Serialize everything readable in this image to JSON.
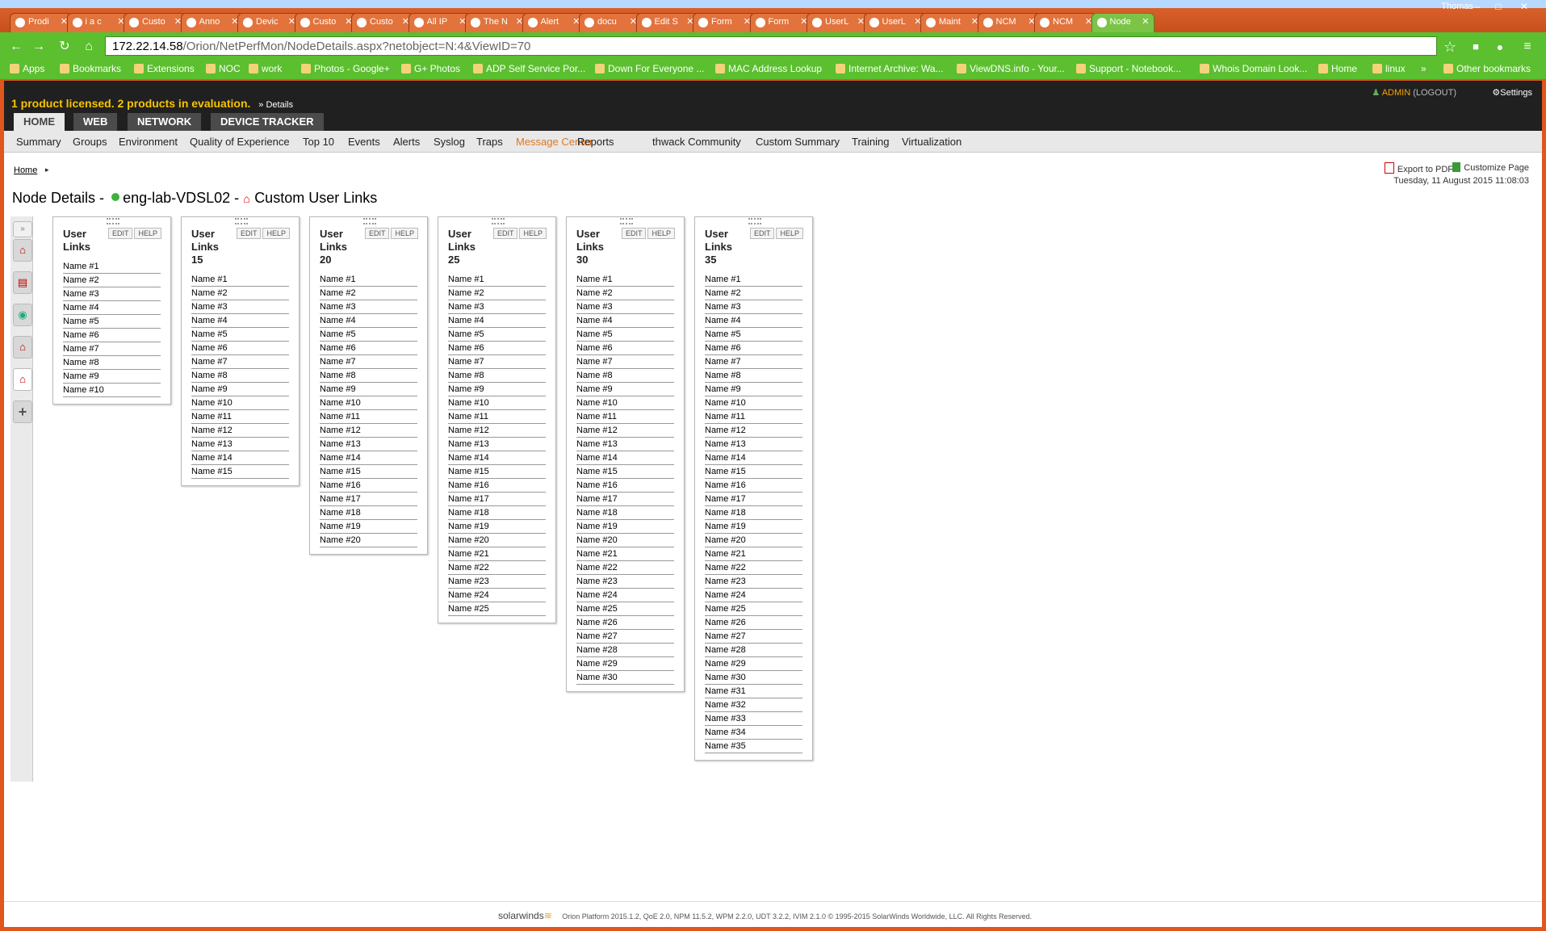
{
  "browser": {
    "tabs": [
      {
        "label": "Prodi"
      },
      {
        "label": "i a c"
      },
      {
        "label": "Custo"
      },
      {
        "label": "Anno"
      },
      {
        "label": "Devic"
      },
      {
        "label": "Custo"
      },
      {
        "label": "Custo"
      },
      {
        "label": "All IP"
      },
      {
        "label": "The N"
      },
      {
        "label": "Alert"
      },
      {
        "label": "docu"
      },
      {
        "label": "Edit S"
      },
      {
        "label": "Form"
      },
      {
        "label": "Form"
      },
      {
        "label": "UserL"
      },
      {
        "label": "UserL"
      },
      {
        "label": "Maint"
      },
      {
        "label": "NCM"
      },
      {
        "label": "NCM"
      },
      {
        "label": "Node"
      }
    ],
    "profile_name": "Thomas",
    "url_host": "172.22.14.58",
    "url_path": "/Orion/NetPerfMon/NodeDetails.aspx?netobject=N:4&ViewID=70",
    "bookmarks": [
      {
        "label": "Apps"
      },
      {
        "label": "Bookmarks"
      },
      {
        "label": "Extensions"
      },
      {
        "label": "NOC"
      },
      {
        "label": "work"
      },
      {
        "label": "Photos - Google+"
      },
      {
        "label": "G+ Photos"
      },
      {
        "label": "ADP Self Service Por..."
      },
      {
        "label": "Down For Everyone ..."
      },
      {
        "label": "MAC Address Lookup"
      },
      {
        "label": "Internet Archive: Wa..."
      },
      {
        "label": "ViewDNS.info - Your..."
      },
      {
        "label": "Support - Notebook..."
      },
      {
        "label": "Whois Domain Look..."
      },
      {
        "label": "Home"
      },
      {
        "label": "linux"
      },
      {
        "label": "»"
      },
      {
        "label": "Other bookmarks"
      }
    ]
  },
  "header": {
    "license_text": "1 product licensed.  2 products in evaluation.",
    "details_link": "» Details",
    "admin_user": "ADMIN",
    "logout": "(LOGOUT)",
    "settings": "Settings",
    "top_tabs": [
      {
        "label": "HOME",
        "active": true
      },
      {
        "label": "WEB",
        "active": false
      },
      {
        "label": "NETWORK",
        "active": false
      },
      {
        "label": "DEVICE TRACKER",
        "active": false
      }
    ],
    "menu": [
      {
        "label": "Summary"
      },
      {
        "label": "Groups"
      },
      {
        "label": "Environment"
      },
      {
        "label": "Quality of Experience"
      },
      {
        "label": "Top 10"
      },
      {
        "label": "Events"
      },
      {
        "label": "Alerts"
      },
      {
        "label": "Syslog"
      },
      {
        "label": "Traps"
      },
      {
        "label": "Message Center"
      },
      {
        "label": "Reports"
      },
      {
        "label": "thwack Community"
      },
      {
        "label": "Custom Summary"
      },
      {
        "label": "Training"
      },
      {
        "label": "Virtualization"
      }
    ]
  },
  "content": {
    "breadcrumb": "Home",
    "export_pdf": "Export to PDF",
    "customize_page": "Customize Page",
    "datetime": "Tuesday, 11 August 2015 11:08:03",
    "title_prefix": "Node Details -",
    "node_name": "eng-lab-VDSL02",
    "title_sep": "-",
    "view_name": "Custom User Links",
    "edit_label": "EDIT",
    "help_label": "HELP",
    "panels": [
      {
        "title": "User Links",
        "count": 10
      },
      {
        "title": "User Links 15",
        "count": 15
      },
      {
        "title": "User Links 20",
        "count": 20
      },
      {
        "title": "User Links 25",
        "count": 25
      },
      {
        "title": "User Links 30",
        "count": 30
      },
      {
        "title": "User Links 35",
        "count": 35
      }
    ],
    "item_prefix": "Name #"
  },
  "footer": {
    "brand": "solarwinds",
    "text": "Orion Platform 2015.1.2, QoE 2.0, NPM 11.5.2, WPM 2.2.0, UDT 3.2.2, IVIM 2.1.0 © 1995-2015 SolarWinds Worldwide, LLC. All Rights Reserved."
  }
}
